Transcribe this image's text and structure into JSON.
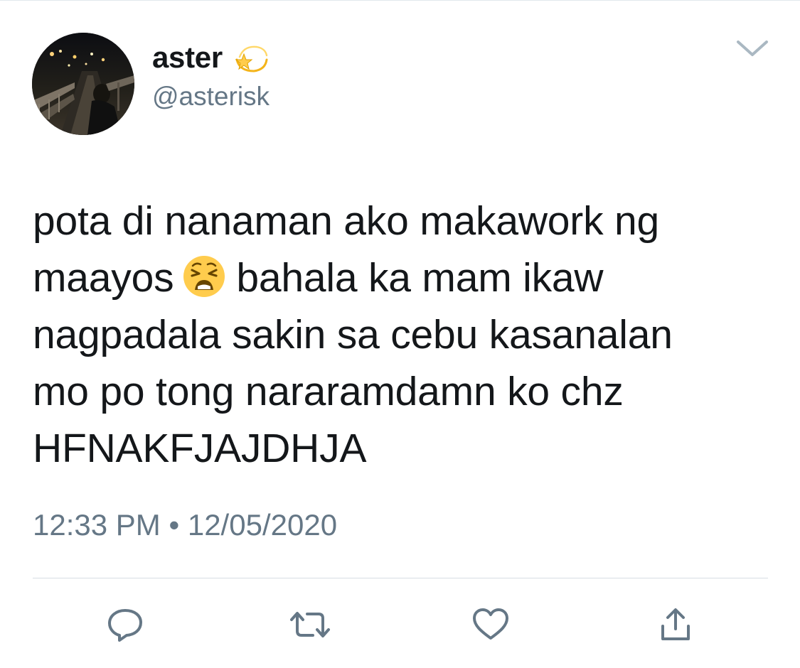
{
  "author": {
    "display_name": "aster",
    "name_emoji": "dizzy-star-emoji",
    "handle": "@asterisk",
    "avatar": "night-street-photo-avatar"
  },
  "tweet": {
    "lines": [
      "pota di nanaman ako makawork ng",
      "maayos",
      "bahala ka mam ikaw",
      "nagpadala sakin sa cebu kasanalan",
      "mo po tong nararamdamn ko chz",
      "HFNAKFJAJDHJA"
    ],
    "inline_emoji": "weary-face-emoji"
  },
  "meta": {
    "time": "12:33 PM",
    "separator": "•",
    "date": "12/05/2020"
  },
  "actions": {
    "reply_icon": "reply-icon",
    "retweet_icon": "retweet-icon",
    "like_icon": "like-icon",
    "share_icon": "share-icon",
    "menu_icon": "chevron-down-icon"
  },
  "colors": {
    "text_primary": "#14171a",
    "text_secondary": "#657786",
    "icon_gray": "#657786",
    "divider": "#d6dde3",
    "emoji_yellow": "#ffcc4d"
  }
}
